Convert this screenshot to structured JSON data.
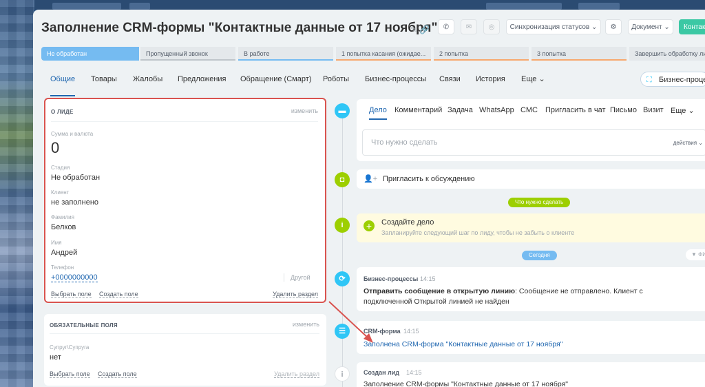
{
  "header": {
    "title": "Заполнение CRM-формы \"Контактные данные от 17 ноября\"",
    "sync_label": "Синхронизация статусов",
    "document_label": "Документ",
    "contact_label": "Контакт"
  },
  "stages": [
    {
      "label": "Не обработан"
    },
    {
      "label": "Пропущенный звонок"
    },
    {
      "label": "В работе"
    },
    {
      "label": "1 попытка касания (ожидае..."
    },
    {
      "label": "2 попытка"
    },
    {
      "label": "3 попытка"
    },
    {
      "label": "Завершить обработку лида"
    }
  ],
  "tabs": [
    "Общие",
    "Товары",
    "Жалобы",
    "Предложения",
    "Обращение (Смарт)",
    "Роботы",
    "Бизнес-процессы",
    "Связи",
    "История",
    "Еще"
  ],
  "bp_button": "Бизнес-процессы",
  "lead": {
    "section_title": "О ЛИДЕ",
    "change": "изменить",
    "fields": [
      {
        "label": "Сумма и валюта",
        "value": "0"
      },
      {
        "label": "Стадия",
        "value": "Не обработан"
      },
      {
        "label": "Клиент",
        "value": "не заполнено"
      },
      {
        "label": "Фамилия",
        "value": "Белков"
      },
      {
        "label": "Имя",
        "value": "Андрей"
      },
      {
        "label": "Телефон",
        "value": "+0000000000",
        "type": "Другой"
      }
    ],
    "select_field": "Выбрать поле",
    "create_field": "Создать поле",
    "delete_section": "Удалить раздел"
  },
  "required": {
    "section_title": "ОБЯЗАТЕЛЬНЫЕ ПОЛЯ",
    "change": "изменить",
    "field_label": "Супруг\\Супруга",
    "field_value": "нет",
    "select_field": "Выбрать поле",
    "create_field": "Создать поле",
    "delete_section": "Удалить раздел"
  },
  "activity_tabs": [
    "Дело",
    "Комментарий",
    "Задача",
    "WhatsApp",
    "СМС",
    "Пригласить в чат",
    "Письмо",
    "Визит",
    "Еще"
  ],
  "activity": {
    "placeholder": "Что нужно сделать",
    "actions": "действия"
  },
  "invite": "Пригласить к обсуждению",
  "todo_pill": "Что нужно сделать",
  "create_task": {
    "title": "Создайте дело",
    "subtitle": "Запланируйте следующий шаг по лиду, чтобы не забыть о клиенте"
  },
  "today_pill": "Сегодня",
  "filter_label": "ФИ",
  "events": [
    {
      "title": "Бизнес-процессы",
      "time": "14:15",
      "bold": "Отправить сообщение в открытую линию",
      "text": ": Сообщение не отправлено. Клиент с подключенной Открытой линией не найден"
    },
    {
      "title": "CRM-форма",
      "time": "14:15",
      "link": "Заполнена CRM-форма \"Контактные данные от 17 ноября\""
    },
    {
      "title": "Создан лид",
      "time": "14:15",
      "text": "Заполнение CRM-формы \"Контактные данные от 17 ноября\""
    }
  ],
  "colors": {
    "accent_blue": "#2067b0",
    "stage_active": "#75bbf1",
    "timeline_green": "#9dcf00",
    "timeline_blue": "#2fc6f6",
    "highlight_red": "#d9534f"
  }
}
